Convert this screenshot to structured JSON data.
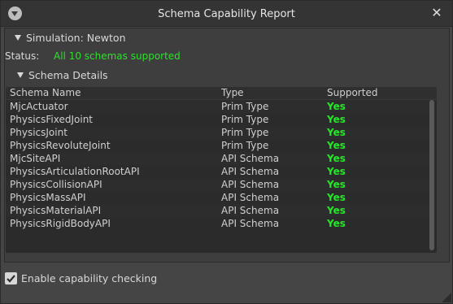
{
  "window": {
    "title": "Schema Capability Report",
    "close_glyph": "✕",
    "menu_icon": "triangle-down-icon"
  },
  "simulation_section": {
    "header": "Simulation: Newton",
    "status_label": "Status:",
    "status_value": "All 10 schemas supported",
    "status_color": "#2ce02c"
  },
  "details_section": {
    "header": "Schema Details"
  },
  "table": {
    "columns": [
      "Schema Name",
      "Type",
      "Supported"
    ],
    "rows": [
      [
        "MjcActuator",
        "Prim Type",
        "Yes"
      ],
      [
        "PhysicsFixedJoint",
        "Prim Type",
        "Yes"
      ],
      [
        "PhysicsJoint",
        "Prim Type",
        "Yes"
      ],
      [
        "PhysicsRevoluteJoint",
        "Prim Type",
        "Yes"
      ],
      [
        "MjcSiteAPI",
        "API Schema",
        "Yes"
      ],
      [
        "PhysicsArticulationRootAPI",
        "API Schema",
        "Yes"
      ],
      [
        "PhysicsCollisionAPI",
        "API Schema",
        "Yes"
      ],
      [
        "PhysicsMassAPI",
        "API Schema",
        "Yes"
      ],
      [
        "PhysicsMaterialAPI",
        "API Schema",
        "Yes"
      ],
      [
        "PhysicsRigidBodyAPI",
        "API Schema",
        "Yes"
      ]
    ]
  },
  "checkbox": {
    "label": "Enable capability checking",
    "checked": true
  }
}
